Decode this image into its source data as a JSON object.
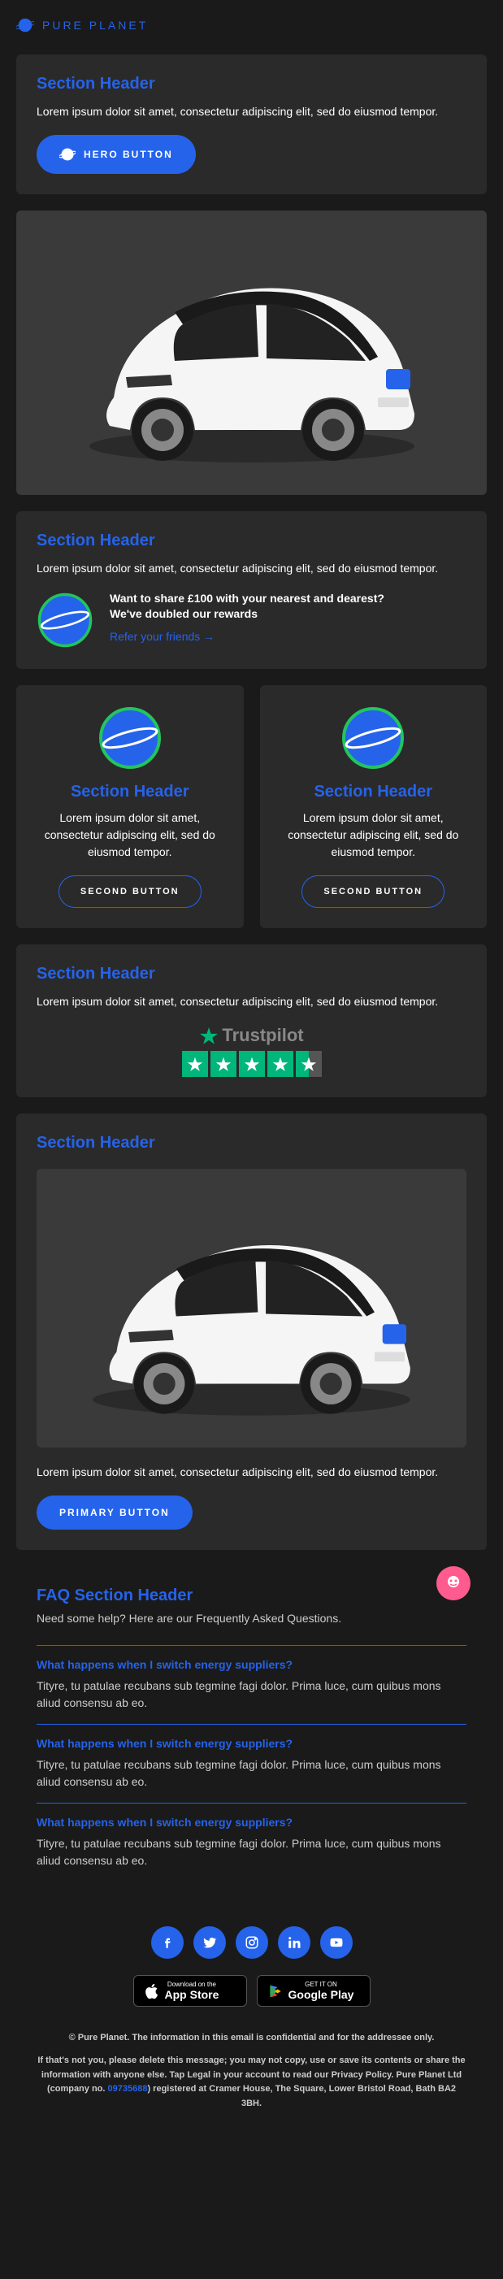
{
  "brand": {
    "name": "PURE PLANET"
  },
  "hero": {
    "header": "Section Header",
    "body": "Lorem ipsum dolor sit amet, consectetur adipiscing elit, sed do eiusmod tempor.",
    "button": "HERO BUTTON"
  },
  "section2": {
    "header": "Section Header",
    "body": "Lorem ipsum dolor sit amet, consectetur adipiscing elit, sed do eiusmod tempor.",
    "promo1": "Want to share £100 with your nearest and dearest?",
    "promo2": "We've doubled our rewards",
    "link": "Refer your friends →"
  },
  "cols": [
    {
      "header": "Section Header",
      "body": "Lorem ipsum dolor sit amet, consectetur adipiscing elit, sed do eiusmod tempor.",
      "button": "SECOND BUTTON"
    },
    {
      "header": "Section Header",
      "body": "Lorem ipsum dolor sit amet, consectetur adipiscing elit, sed do eiusmod tempor.",
      "button": "SECOND BUTTON"
    }
  ],
  "section3": {
    "header": "Section Header",
    "body": "Lorem ipsum dolor sit amet, consectetur adipiscing elit, sed do eiusmod tempor.",
    "trustpilot": "Trustpilot"
  },
  "section4": {
    "header": "Section Header",
    "body": "Lorem ipsum dolor sit amet, consectetur adipiscing elit, sed do eiusmod tempor.",
    "button": "PRIMARY BUTTON"
  },
  "faq": {
    "header": "FAQ Section Header",
    "sub": "Need some help? Here are our Frequently Asked Questions.",
    "items": [
      {
        "q": "What happens when I switch energy suppliers?",
        "a": "Tityre, tu patulae recubans sub tegmine fagi dolor. Prima luce, cum quibus mons aliud consensu ab eo."
      },
      {
        "q": "What happens when I switch energy suppliers?",
        "a": "Tityre, tu patulae recubans sub tegmine fagi dolor. Prima luce, cum quibus mons aliud consensu ab eo."
      },
      {
        "q": "What happens when I switch energy suppliers?",
        "a": "Tityre, tu patulae recubans sub tegmine fagi dolor. Prima luce, cum quibus mons aliud consensu ab eo."
      }
    ]
  },
  "footer": {
    "appstore_small": "Download on the",
    "appstore_big": "App Store",
    "gplay_small": "GET IT ON",
    "gplay_big": "Google Play",
    "line1": "© Pure Planet. The information in this email is confidential and for the addressee only.",
    "line2a": "If that's not you, please delete this message; you may not copy, use or save its contents or share the information with anyone else. Tap Legal in your account to read our Privacy Policy. Pure Planet Ltd (company no. ",
    "company_num": "09735688",
    "line2b": ") registered at Cramer House, The Square, Lower Bristol Road, Bath BA2 3BH."
  }
}
